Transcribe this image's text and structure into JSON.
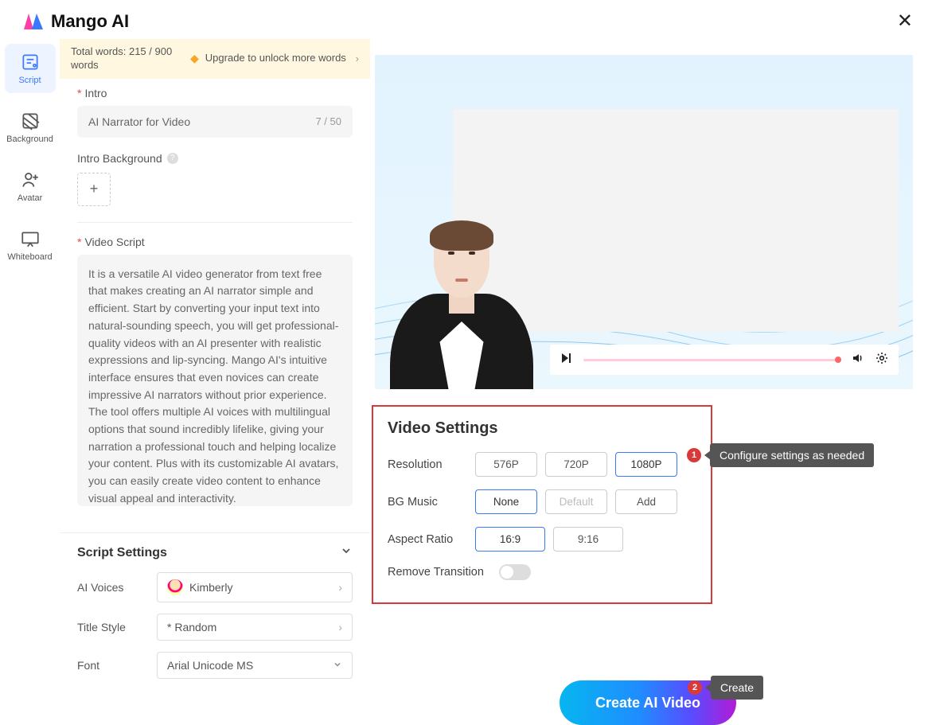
{
  "brand": {
    "name": "Mango AI"
  },
  "sidebar": [
    {
      "label": "Script"
    },
    {
      "label": "Background"
    },
    {
      "label": "Avatar"
    },
    {
      "label": "Whiteboard"
    }
  ],
  "topbar": {
    "word_count": "Total words: 215 / 900 words",
    "upgrade": "Upgrade to unlock more words"
  },
  "intro": {
    "label": "Intro",
    "value": "AI Narrator for Video",
    "counter": "7 / 50",
    "bg_label": "Intro Background"
  },
  "video_script": {
    "label": "Video Script",
    "text": "It is a versatile AI video generator from text free that makes creating an AI narrator simple and efficient. Start by converting your input text into natural-sounding speech, you will get professional-quality videos with an AI presenter with realistic expressions and lip-syncing. Mango AI's intuitive interface ensures that even novices can create impressive AI narrators without prior experience. The tool offers multiple AI voices with multilingual options that sound incredibly lifelike, giving your narration a professional touch and helping localize your content. Plus with its customizable AI avatars, you can easily create video content to enhance visual appeal and interactivity."
  },
  "script_settings": {
    "title": "Script Settings",
    "voices": {
      "label": "AI Voices",
      "value": "Kimberly"
    },
    "titlestyle": {
      "label": "Title Style",
      "value": "* Random"
    },
    "font": {
      "label": "Font",
      "value": "Arial Unicode MS"
    }
  },
  "video_settings": {
    "title": "Video Settings",
    "resolution": {
      "label": "Resolution",
      "options": [
        "576P",
        "720P",
        "1080P"
      ],
      "selected": "1080P"
    },
    "bgmusic": {
      "label": "BG Music",
      "options": [
        "None",
        "Default",
        "Add"
      ],
      "selected": "None"
    },
    "aspect": {
      "label": "Aspect Ratio",
      "options": [
        "16:9",
        "9:16"
      ],
      "selected": "16:9"
    },
    "transition": {
      "label": "Remove Transition"
    }
  },
  "callouts": {
    "c1_num": "1",
    "c1_text": "Configure settings as needed",
    "c2_num": "2",
    "c2_text": "Create"
  },
  "cta": "Create AI Video"
}
